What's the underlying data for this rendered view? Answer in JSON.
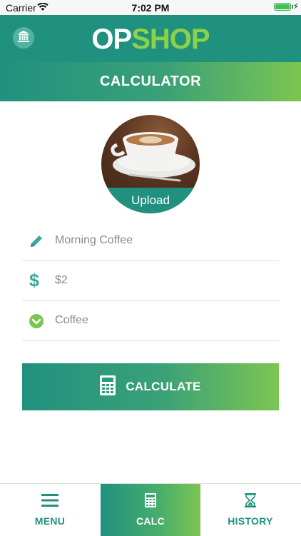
{
  "status_bar": {
    "carrier": "Carrier",
    "time": "7:02 PM"
  },
  "header": {
    "logo_op": "OP",
    "logo_shop": "SHOP",
    "title": "CALCULATOR"
  },
  "photo": {
    "upload_label": "Upload"
  },
  "form": {
    "name_value": "Morning Coffee",
    "price_value": "$2",
    "category_value": "Coffee"
  },
  "calculate_button": {
    "label": "CALCULATE"
  },
  "tabs": [
    {
      "label": "MENU"
    },
    {
      "label": "CALC"
    },
    {
      "label": "HISTORY"
    }
  ],
  "colors": {
    "teal": "#21917f",
    "green": "#7cc551",
    "logo_green": "#8bd24a",
    "icon_teal": "#3aa79b"
  },
  "icons": [
    "bank-icon",
    "pencil-icon",
    "dollar-icon",
    "chevron-check-icon",
    "calculator-icon",
    "menu-icon",
    "hourglass-icon"
  ]
}
